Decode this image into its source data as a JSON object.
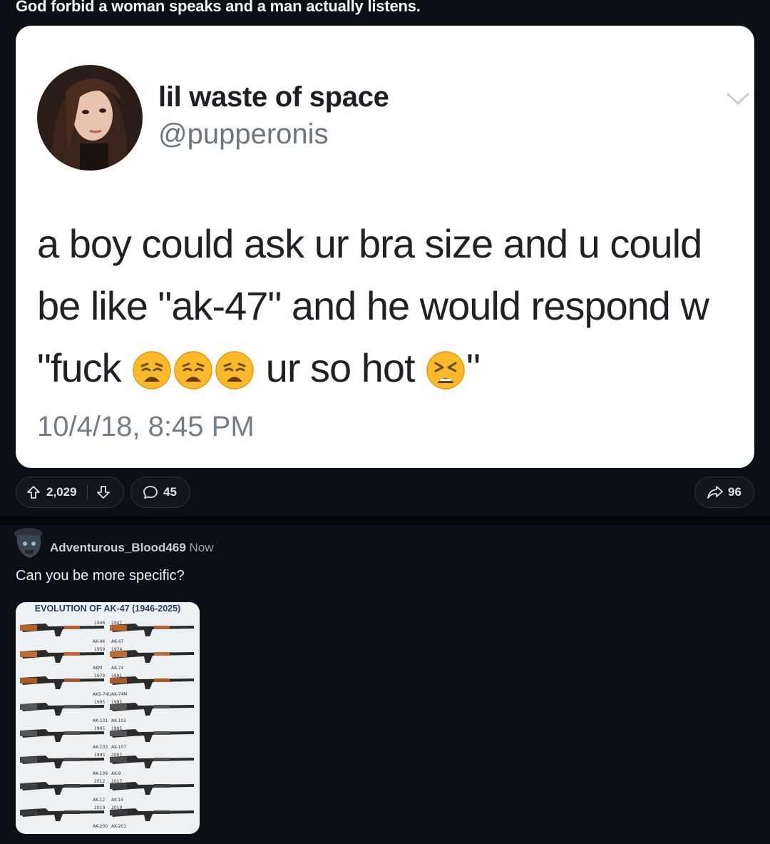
{
  "post": {
    "title": "God forbid a woman speaks and a man actually listens."
  },
  "tweet": {
    "display_name": "lil waste of space",
    "handle": "@pupperonis",
    "text_line1": "a boy could ask ur bra size and u could",
    "text_line2": "be like \"ak-47\" and he would respond w",
    "text_line3a": "\"fuck ",
    "text_line3b": " ur so hot ",
    "text_line3c": "\"",
    "timestamp": "10/4/18, 8:45 PM",
    "emojis": [
      "weary-face-icon",
      "weary-face-icon",
      "weary-face-icon",
      "tired-face-icon"
    ]
  },
  "actions": {
    "upvotes": "2,029",
    "comments": "45",
    "shares": "96"
  },
  "comment": {
    "username": "Adventurous_Blood469",
    "time": "Now",
    "text": "Can you be more specific?"
  },
  "infographic": {
    "title": "EVOLUTION OF AK-47 (1946-2025)",
    "rows": [
      {
        "left_model": "AK-46",
        "right_model": "AK-47",
        "left_year": "1946",
        "right_year": "1947"
      },
      {
        "left_model": "AKM",
        "right_model": "AK-74",
        "left_year": "1959",
        "right_year": "1974"
      },
      {
        "left_model": "AKS-74U",
        "right_model": "AK-74M",
        "left_year": "1979",
        "right_year": "1991"
      },
      {
        "left_model": "AK-101",
        "right_model": "AK-102",
        "left_year": "1995",
        "right_year": "1995"
      },
      {
        "left_model": "AK-103",
        "right_model": "AK-107",
        "left_year": "1995",
        "right_year": "1995"
      },
      {
        "left_model": "AK-109",
        "right_model": "AK-9",
        "left_year": "1995",
        "right_year": "2007"
      },
      {
        "left_model": "AK-12",
        "right_model": "AK-15",
        "left_year": "2012",
        "right_year": "2017"
      },
      {
        "left_model": "AK-200",
        "right_model": "AK-201",
        "left_year": "2019",
        "right_year": "2019"
      }
    ]
  },
  "colors": {
    "background": "#0b1016",
    "card": "#ffffff",
    "emoji_yellow": "#f8b92b"
  }
}
